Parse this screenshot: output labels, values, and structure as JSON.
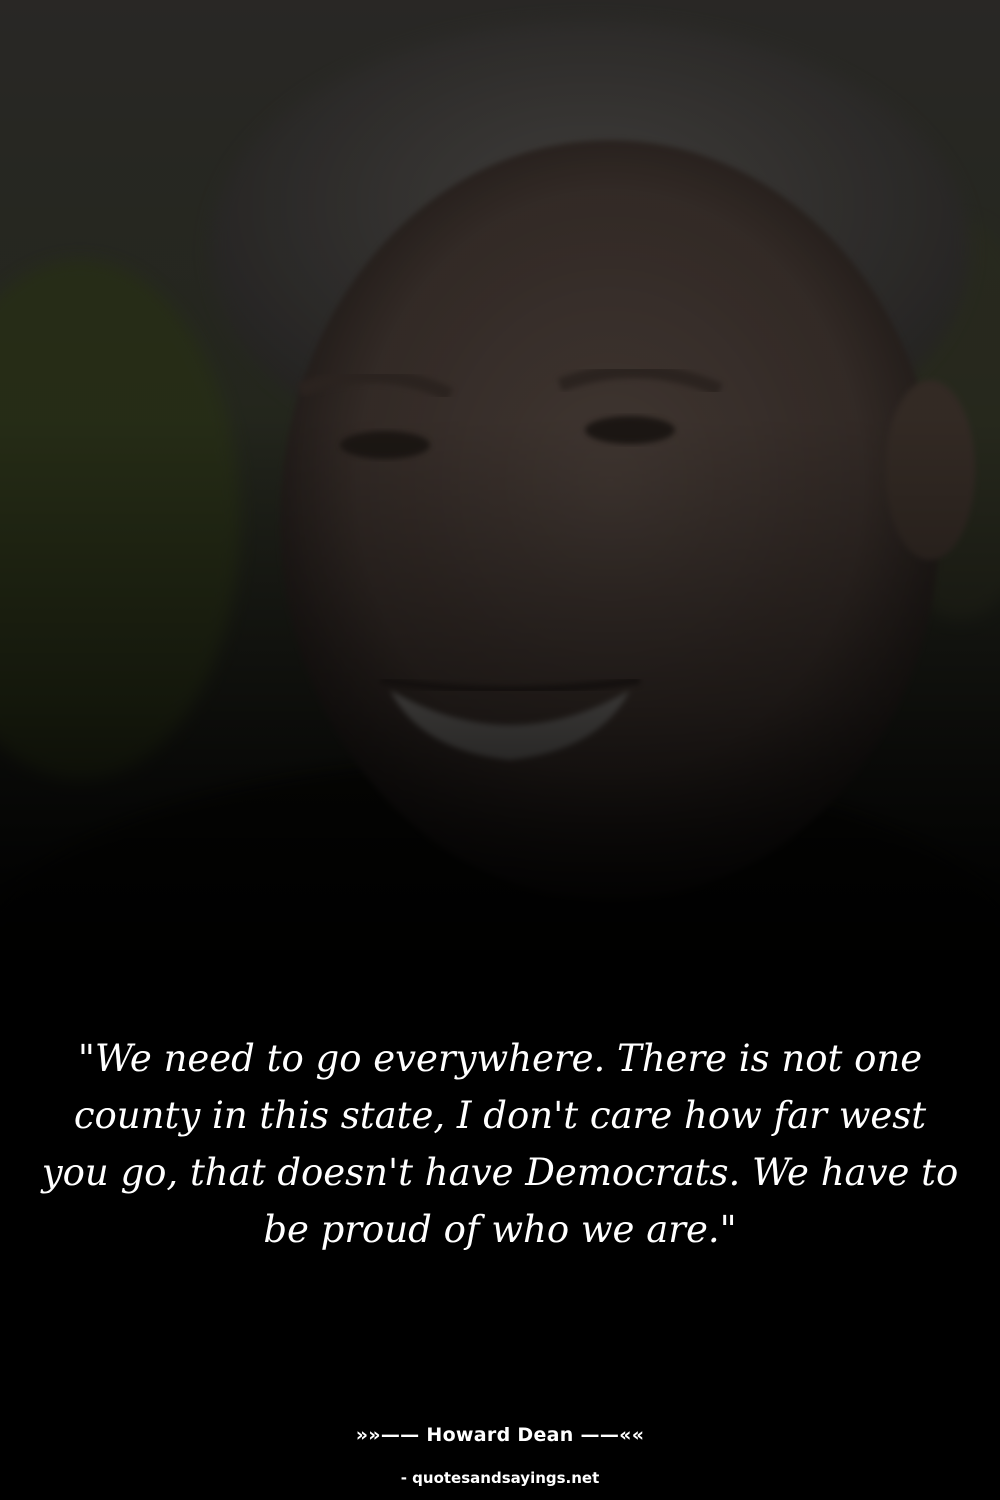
{
  "quote": {
    "text": "\"We need to go everywhere. There is not one county in this state, I don't care how far west you go, that doesn't have Democrats. We have to be proud of who we are.\""
  },
  "author": {
    "line": "»»—— Howard Dean ——««"
  },
  "source": {
    "line": "- quotesandsayings.net"
  },
  "colors": {
    "background": "#000000",
    "text": "#ffffff",
    "foliage": "#4a5a2c",
    "skin": "#8a7468"
  }
}
